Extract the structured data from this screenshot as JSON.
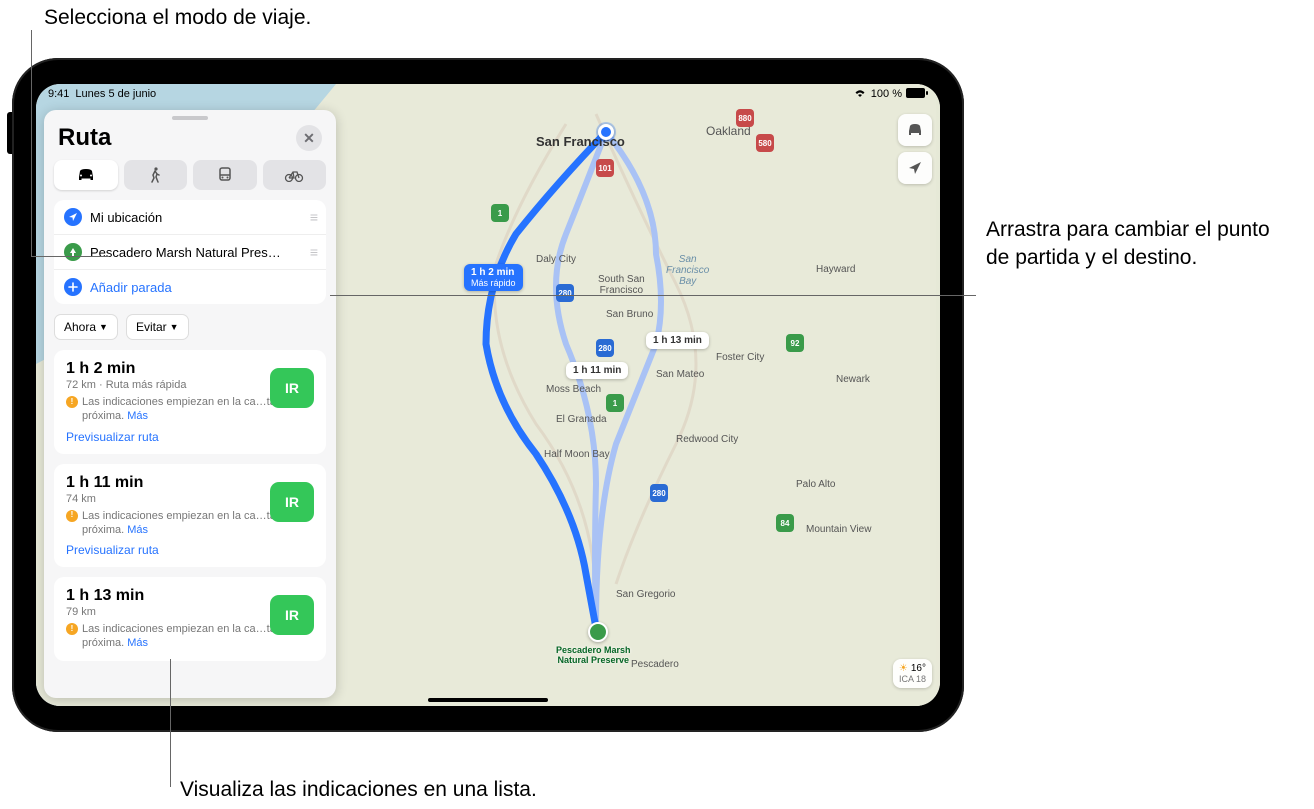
{
  "callouts": {
    "mode": "Selecciona el modo de viaje.",
    "drag": "Arrastra para cambiar el punto de partida y el destino.",
    "list": "Visualiza las indicaciones en una lista."
  },
  "status": {
    "time": "9:41",
    "date": "Lunes 5 de junio",
    "battery": "100 %"
  },
  "panel": {
    "title": "Ruta",
    "stops": {
      "from": "Mi ubicación",
      "to": "Pescadero Marsh Natural Pres…",
      "add": "Añadir parada"
    },
    "options": {
      "now": "Ahora",
      "avoid": "Evitar"
    }
  },
  "routes": [
    {
      "time": "1 h 2 min",
      "dist": "72 km · Ruta más rápida",
      "note": "Las indicaciones empiezan en la ca…ta más próxima.",
      "more": "Más",
      "go": "IR",
      "preview": "Previsualizar ruta"
    },
    {
      "time": "1 h 11 min",
      "dist": "74 km",
      "note": "Las indicaciones empiezan en la ca…ta más próxima.",
      "more": "Más",
      "go": "IR",
      "preview": "Previsualizar ruta"
    },
    {
      "time": "1 h 13 min",
      "dist": "79 km",
      "note": "Las indicaciones empiezan en la ca…ta más próxima.",
      "more": "Más",
      "go": "IR",
      "preview": ""
    }
  ],
  "map": {
    "bubble_primary_time": "1 h 2 min",
    "bubble_primary_sub": "Más rápido",
    "bubble_alt1": "1 h 11 min",
    "bubble_alt2": "1 h 13 min",
    "dest_label": "Pescadero Marsh\nNatural Preserve",
    "cities": {
      "sf": "San Francisco",
      "oakland": "Oakland",
      "daly": "Daly City",
      "ssf": "South San\nFrancisco",
      "sanbruno": "San Bruno",
      "sfbay": "San\nFrancisco\nBay",
      "sanmateo": "San Mateo",
      "foster": "Foster City",
      "hayward": "Hayward",
      "newark": "Newark",
      "paloalto": "Palo Alto",
      "mtnview": "Mountain View",
      "redwood": "Redwood City",
      "halfmoon": "Half Moon Bay",
      "mossbeach": "Moss Beach",
      "elgranada": "El Granada",
      "sangregorio": "San Gregorio",
      "pescadero": "Pescadero"
    },
    "weather_temp": "16°",
    "weather_aqi": "ICA 18"
  },
  "shields": {
    "101": "101",
    "280": "280",
    "1": "1",
    "580": "580",
    "880": "880",
    "92": "92",
    "84": "84"
  }
}
